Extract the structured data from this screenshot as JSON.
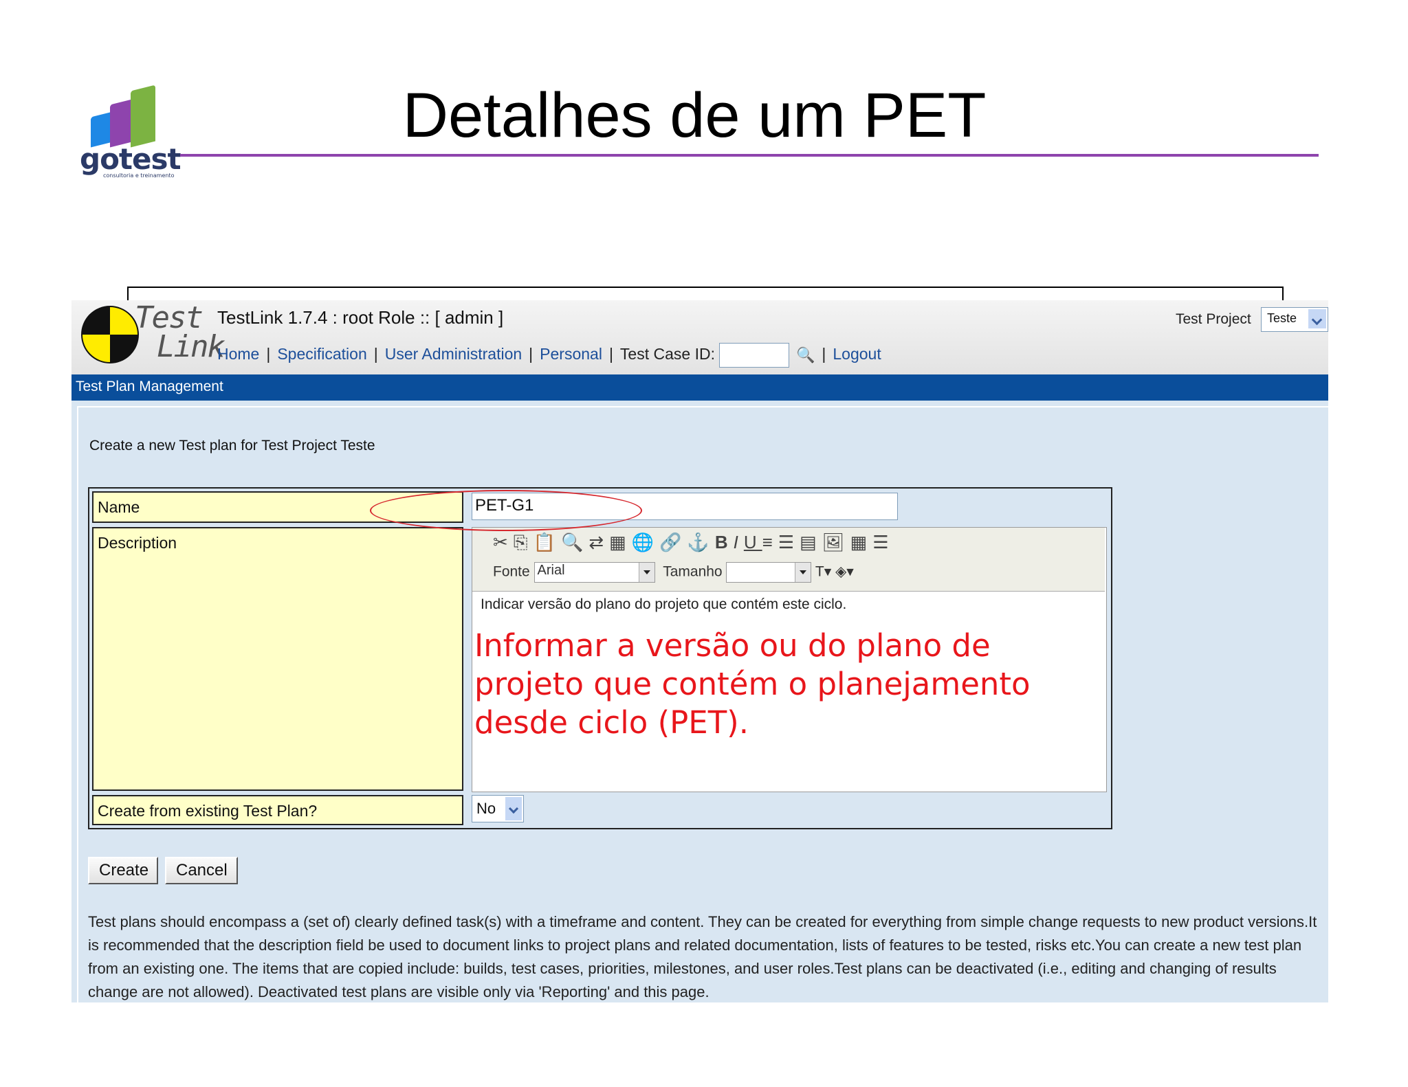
{
  "slide": {
    "title": "Detalhes de um PET",
    "logo_text": "gotest",
    "logo_tagline": "consultoria e treinamento",
    "annotation": "Informar a versão ou do plano de projeto que contém o planejamento desde ciclo (PET)."
  },
  "app": {
    "logo_line1": "Test",
    "logo_line2": "Link",
    "title": "TestLink 1.7.4 : root Role :: [ admin ]",
    "project_label": "Test Project",
    "project_value": "Teste",
    "nav": {
      "home": "Home",
      "specification": "Specification",
      "user_admin": "User Administration",
      "personal": "Personal",
      "test_case_id": "Test Case ID:",
      "logout": "Logout"
    },
    "section_title": "Test Plan Management",
    "intro": "Create a new Test plan for Test Project Teste",
    "form": {
      "name_label": "Name",
      "name_value": "PET-G1",
      "description_label": "Description",
      "copy_label": "Create from existing Test Plan?",
      "copy_value": "No",
      "editor": {
        "font_label": "Fonte",
        "font_value": "Arial",
        "size_label": "Tamanho",
        "size_value": "",
        "text": "Indicar versão do plano do projeto que contém este ciclo."
      }
    },
    "buttons": {
      "create": "Create",
      "cancel": "Cancel"
    },
    "help_text": "Test plans should encompass a (set of) clearly defined task(s) with a timeframe and content. They can be created for everything from simple change requests to new product versions.It is recommended that the description field be used to document links to project plans and related documentation, lists of features to be tested, risks etc.You can create a new test plan from an existing one. The items that are copied include: builds, test cases, priorities, milestones, and user roles.Test plans can be deactivated (i.e., editing and changing of results change are not allowed). Deactivated test plans are visible only via 'Reporting' and this page."
  },
  "colors": {
    "accent_line": "#8e44ad",
    "header_bar": "#0a4e9b",
    "label_bg": "#ffffc8",
    "annotation": "#e8161b"
  }
}
